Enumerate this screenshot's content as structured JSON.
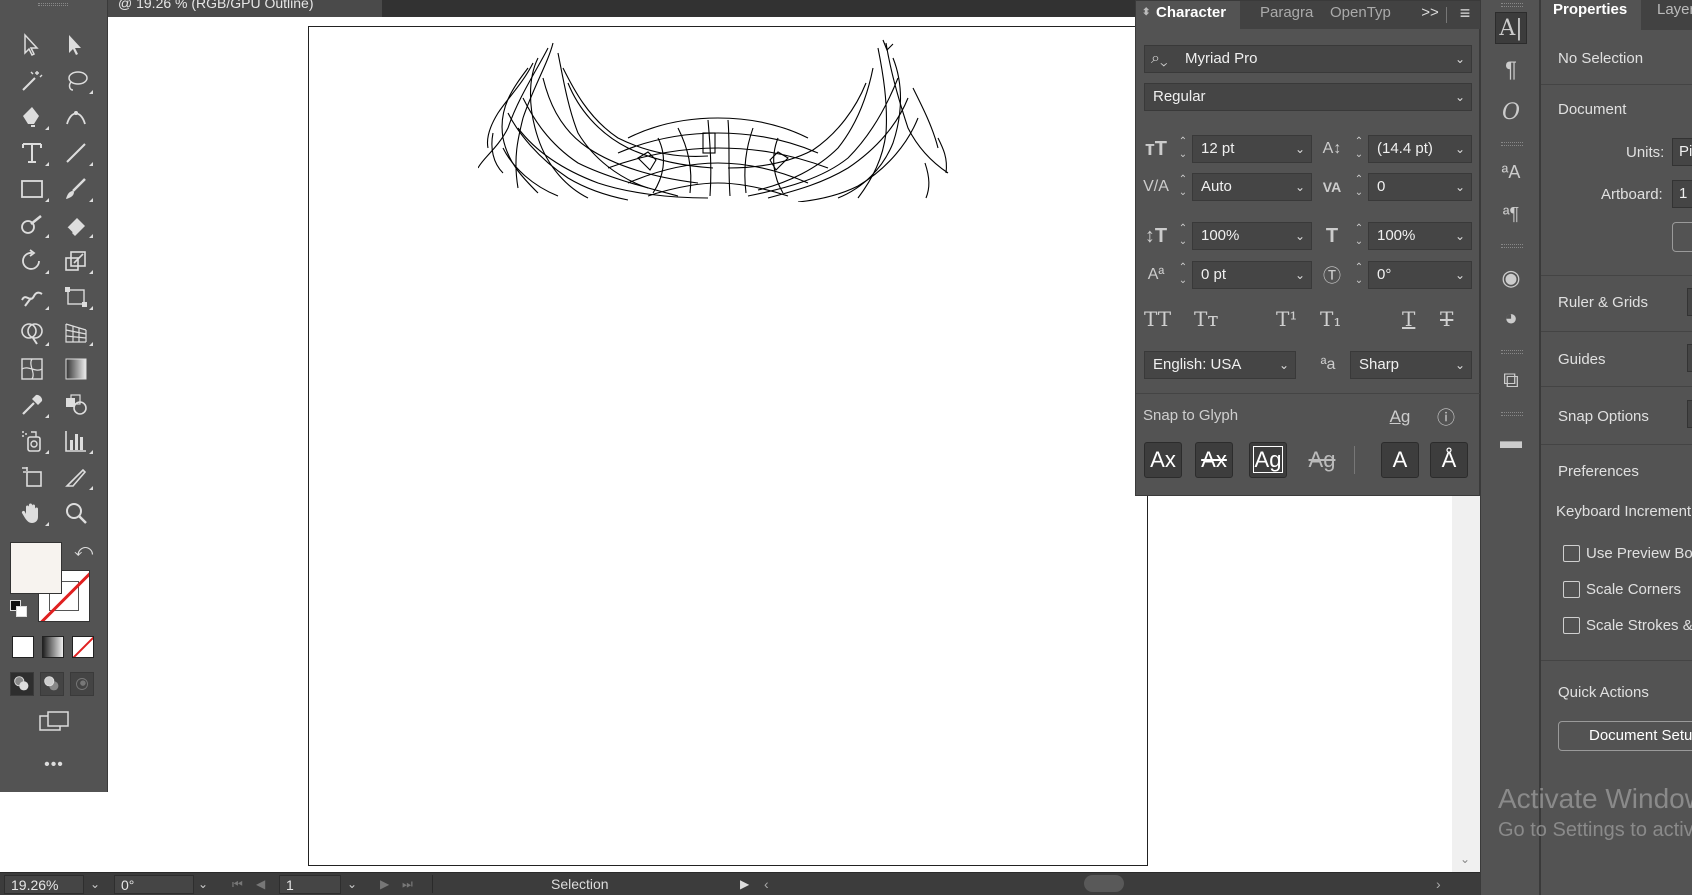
{
  "document": {
    "tab_title": "@ 19.26 % (RGB/GPU Outline)"
  },
  "toolbar": {
    "tools": [
      "selection-tool",
      "direct-selection-tool",
      "magic-wand-tool",
      "lasso-tool",
      "pen-tool",
      "curvature-tool",
      "type-tool",
      "line-segment-tool",
      "rectangle-tool",
      "paintbrush-tool",
      "shaper-tool",
      "eraser-tool",
      "rotate-tool",
      "scale-tool",
      "warp-tool",
      "free-transform-tool",
      "shape-builder-tool",
      "perspective-grid-tool",
      "mesh-tool",
      "gradient-tool",
      "eyedropper-tool",
      "blend-tool",
      "symbol-sprayer-tool",
      "column-graph-tool",
      "artboard-tool",
      "slice-tool",
      "hand-tool",
      "zoom-tool"
    ],
    "more_label": "•••",
    "fill_color": "#f7f3ef",
    "stroke_color": "none"
  },
  "character_panel": {
    "tabs": [
      "Character",
      "Paragrap",
      "OpenTyp"
    ],
    "expand_label": ">>",
    "font_family": "Myriad Pro",
    "font_style": "Regular",
    "font_size": "12 pt",
    "leading": "(14.4 pt)",
    "kerning": "Auto",
    "tracking": "0",
    "vertical_scale": "100%",
    "horizontal_scale": "100%",
    "baseline_shift": "0 pt",
    "rotation": "0°",
    "language": "English: USA",
    "antialiasing": "Sharp",
    "snap_label": "Snap to Glyph"
  },
  "properties_panel": {
    "tabs": [
      "Properties",
      "Layers"
    ],
    "no_selection": "No Selection",
    "document_heading": "Document",
    "units_label": "Units:",
    "units_value": "Pixels",
    "artboard_label": "Artboard:",
    "artboard_value": "1",
    "ruler_grids": "Ruler & Grids",
    "guides": "Guides",
    "snap_options": "Snap Options",
    "preferences": "Preferences",
    "keyboard_increment": "Keyboard Increment:",
    "use_preview_bounds": "Use Preview Bounds",
    "scale_corners": "Scale Corners",
    "scale_strokes": "Scale Strokes & Effects",
    "quick_actions": "Quick Actions",
    "document_setup": "Document Setup"
  },
  "statusbar": {
    "zoom": "19.26%",
    "rotation": "0°",
    "artboard_number": "1",
    "tool_name": "Selection"
  },
  "watermark": {
    "line1": "Activate Windows",
    "line2": "Go to Settings to activate Windows."
  }
}
